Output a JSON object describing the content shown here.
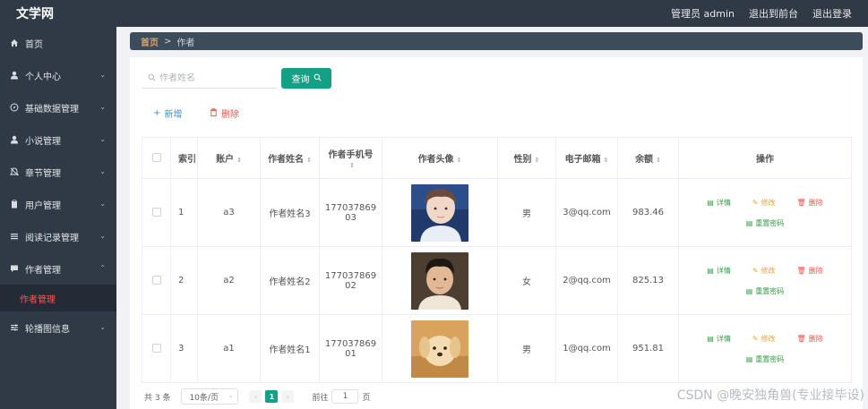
{
  "header": {
    "logo": "文学网",
    "admin_label": "管理员 admin",
    "back_to_front": "退出到前台",
    "logout": "退出登录"
  },
  "sidebar": {
    "items": [
      {
        "label": "首页",
        "icon": "home-icon",
        "expandable": false
      },
      {
        "label": "个人中心",
        "icon": "user-icon",
        "expandable": true
      },
      {
        "label": "基础数据管理",
        "icon": "compass-icon",
        "expandable": true
      },
      {
        "label": "小说管理",
        "icon": "user-icon",
        "expandable": true
      },
      {
        "label": "章节管理",
        "icon": "bell-icon",
        "expandable": true
      },
      {
        "label": "用户管理",
        "icon": "clipboard-icon",
        "expandable": true
      },
      {
        "label": "阅读记录管理",
        "icon": "list-icon",
        "expandable": true
      },
      {
        "label": "作者管理",
        "icon": "comment-icon",
        "expandable": true,
        "expanded": true
      },
      {
        "label": "轮播图信息",
        "icon": "sliders-icon",
        "expandable": true
      }
    ],
    "active_sub": "作者管理"
  },
  "breadcrumb": {
    "home": "首页",
    "separator": ">",
    "current": "作者"
  },
  "search": {
    "placeholder": "作者姓名",
    "query_button": "查询"
  },
  "actions": {
    "add": "新增",
    "delete": "删除"
  },
  "table": {
    "headers": [
      "索引",
      "账户",
      "作者姓名",
      "作者手机号",
      "作者头像",
      "性别",
      "电子邮箱",
      "余额",
      "操作"
    ],
    "rows": [
      {
        "index": "1",
        "account": "a3",
        "name": "作者姓名3",
        "phone": "17703786903",
        "gender": "男",
        "email": "3@qq.com",
        "balance": "983.46"
      },
      {
        "index": "2",
        "account": "a2",
        "name": "作者姓名2",
        "phone": "17703786902",
        "gender": "女",
        "email": "2@qq.com",
        "balance": "825.13"
      },
      {
        "index": "3",
        "account": "a1",
        "name": "作者姓名1",
        "phone": "17703786901",
        "gender": "男",
        "email": "1@qq.com",
        "balance": "951.81"
      }
    ],
    "ops": {
      "detail": "详情",
      "edit": "修改",
      "delete": "删除",
      "reset_password": "重置密码"
    }
  },
  "pagination": {
    "total": "共 3 条",
    "page_size": "10条/页",
    "current_page": "1",
    "goto_label": "前往",
    "goto_value": "1",
    "page_suffix": "页"
  },
  "watermark": "CSDN @晚安独角兽(专业接毕设)",
  "colors": {
    "sidebar_bg": "#2f3a46",
    "accent": "#14a085",
    "danger": "#e8504b",
    "link": "#3a8ee6"
  }
}
